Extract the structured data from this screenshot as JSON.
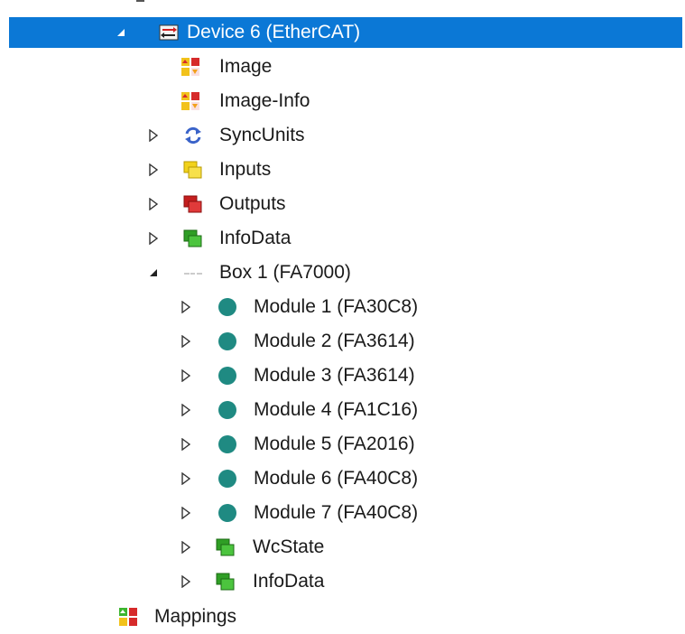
{
  "tree": {
    "items": [
      {
        "label": "Device 6 (EtherCAT)",
        "icon": "ethercat-device-icon",
        "expander": "expanded",
        "selected": true
      },
      {
        "label": "Image",
        "icon": "image-icon",
        "expander": "none"
      },
      {
        "label": "Image-Info",
        "icon": "image-info-icon",
        "expander": "none"
      },
      {
        "label": "SyncUnits",
        "icon": "sync-units-icon",
        "expander": "collapsed"
      },
      {
        "label": "Inputs",
        "icon": "inputs-icon",
        "expander": "collapsed"
      },
      {
        "label": "Outputs",
        "icon": "outputs-icon",
        "expander": "collapsed"
      },
      {
        "label": "InfoData",
        "icon": "infodata-icon",
        "expander": "collapsed"
      },
      {
        "label": "Box 1 (FA7000)",
        "icon": "box-icon",
        "expander": "expanded"
      },
      {
        "label": "Module 1 (FA30C8)",
        "icon": "module-icon",
        "expander": "collapsed"
      },
      {
        "label": "Module 2 (FA3614)",
        "icon": "module-icon",
        "expander": "collapsed"
      },
      {
        "label": "Module 3 (FA3614)",
        "icon": "module-icon",
        "expander": "collapsed"
      },
      {
        "label": "Module 4 (FA1C16)",
        "icon": "module-icon",
        "expander": "collapsed"
      },
      {
        "label": "Module 5 (FA2016)",
        "icon": "module-icon",
        "expander": "collapsed"
      },
      {
        "label": "Module 6 (FA40C8)",
        "icon": "module-icon",
        "expander": "collapsed"
      },
      {
        "label": "Module 7 (FA40C8)",
        "icon": "module-icon",
        "expander": "collapsed"
      },
      {
        "label": "WcState",
        "icon": "wcstate-icon",
        "expander": "collapsed"
      },
      {
        "label": "InfoData",
        "icon": "infodata-icon",
        "expander": "collapsed"
      },
      {
        "label": "Mappings",
        "icon": "mappings-icon",
        "expander": "none"
      }
    ]
  },
  "colors": {
    "selection": "#0b78d6",
    "module": "#1f8a82",
    "inputs": "#f2d21b",
    "outputs": "#d62a2a",
    "infodata": "#3cb52f"
  }
}
